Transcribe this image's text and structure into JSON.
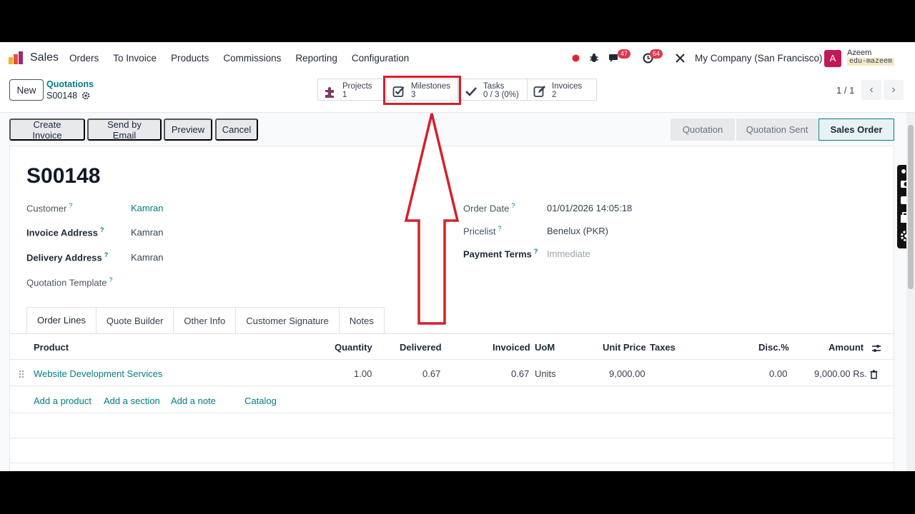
{
  "app": {
    "name": "Sales"
  },
  "menu": [
    "Orders",
    "To Invoice",
    "Products",
    "Commissions",
    "Reporting",
    "Configuration"
  ],
  "systray": {
    "messages_count": "47",
    "activities_count": "64",
    "company": "My Company (San Francisco)",
    "user_initial": "A",
    "user_name": "Azeem",
    "db_name": "edu-mazeem"
  },
  "control_panel": {
    "new_label": "New",
    "breadcrumb_parent": "Quotations",
    "breadcrumb_current": "S00148",
    "smart_buttons": [
      {
        "label": "Projects",
        "value": "1",
        "icon": "puzzle-icon"
      },
      {
        "label": "Milestones",
        "value": "3",
        "icon": "checkbox-icon"
      },
      {
        "label": "Tasks",
        "value": "0 / 3 (0%)",
        "icon": "check-icon"
      },
      {
        "label": "Invoices",
        "value": "2",
        "icon": "edit-icon"
      }
    ],
    "pager": "1 / 1"
  },
  "actions": [
    "Create Invoice",
    "Send by Email",
    "Preview",
    "Cancel"
  ],
  "statusbar": [
    "Quotation",
    "Quotation Sent",
    "Sales Order"
  ],
  "form": {
    "title": "S00148",
    "customer_label": "Customer",
    "customer": "Kamran",
    "invoice_address_label": "Invoice Address",
    "invoice_address": "Kamran",
    "delivery_address_label": "Delivery Address",
    "delivery_address": "Kamran",
    "quotation_template_label": "Quotation Template",
    "order_date_label": "Order Date",
    "order_date": "01/01/2026 14:05:18",
    "pricelist_label": "Pricelist",
    "pricelist": "Benelux (PKR)",
    "payment_terms_label": "Payment Terms",
    "payment_terms": "Immediate",
    "help_mark": "?"
  },
  "tabs": [
    "Order Lines",
    "Quote Builder",
    "Other Info",
    "Customer Signature",
    "Notes"
  ],
  "table": {
    "headers": [
      "Product",
      "Quantity",
      "Delivered",
      "Invoiced",
      "UoM",
      "Unit Price",
      "Taxes",
      "Disc.%",
      "Amount"
    ],
    "rows": [
      {
        "product": "Website Development Services",
        "quantity": "1.00",
        "delivered": "0.67",
        "invoiced": "0.67",
        "uom": "Units",
        "unit_price": "9,000.00",
        "taxes": "",
        "discount": "0.00",
        "amount": "9,000.00 Rs."
      }
    ],
    "add_links": [
      "Add a product",
      "Add a section",
      "Add a note",
      "Catalog"
    ]
  },
  "colors": {
    "accent": "#017e84",
    "annotation": "#d6202b",
    "badge": "#e2364a"
  }
}
